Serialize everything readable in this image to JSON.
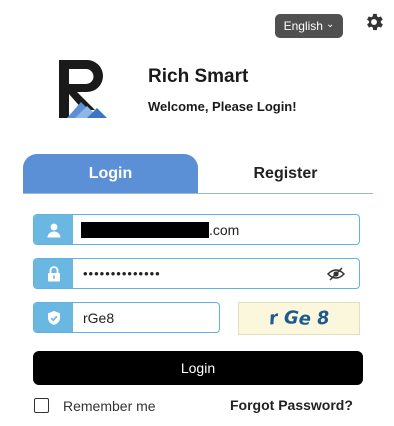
{
  "header": {
    "language_label": "English",
    "language_icon": "chevron-down-icon",
    "settings_icon": "gear-icon"
  },
  "brand": {
    "app_name": "Rich Smart",
    "welcome": "Welcome, Please Login!",
    "logo_icon": "rs-logo"
  },
  "tabs": [
    {
      "label": "Login",
      "active": true
    },
    {
      "label": "Register",
      "active": false
    }
  ],
  "form": {
    "username": {
      "visible_suffix": ".com",
      "icon": "user-icon",
      "redacted": true
    },
    "password": {
      "masked_value": "••••••••••••••",
      "icon": "lock-icon",
      "toggle_icon": "eye-slash-icon"
    },
    "captcha": {
      "value": "rGe8",
      "icon": "shield-icon",
      "image_chars": [
        "r",
        "Ge",
        "8"
      ]
    },
    "login_button": "Login",
    "remember_me": {
      "label": "Remember me",
      "checked": false
    },
    "forgot_password": "Forgot Password?"
  },
  "colors": {
    "accent": "#5b8fd6",
    "icon_bg": "#6ab8e2",
    "border": "#5fb3df",
    "captcha_bg": "#fbf7dc",
    "captcha_text": "#1d5b8e",
    "button_bg": "#000000"
  }
}
